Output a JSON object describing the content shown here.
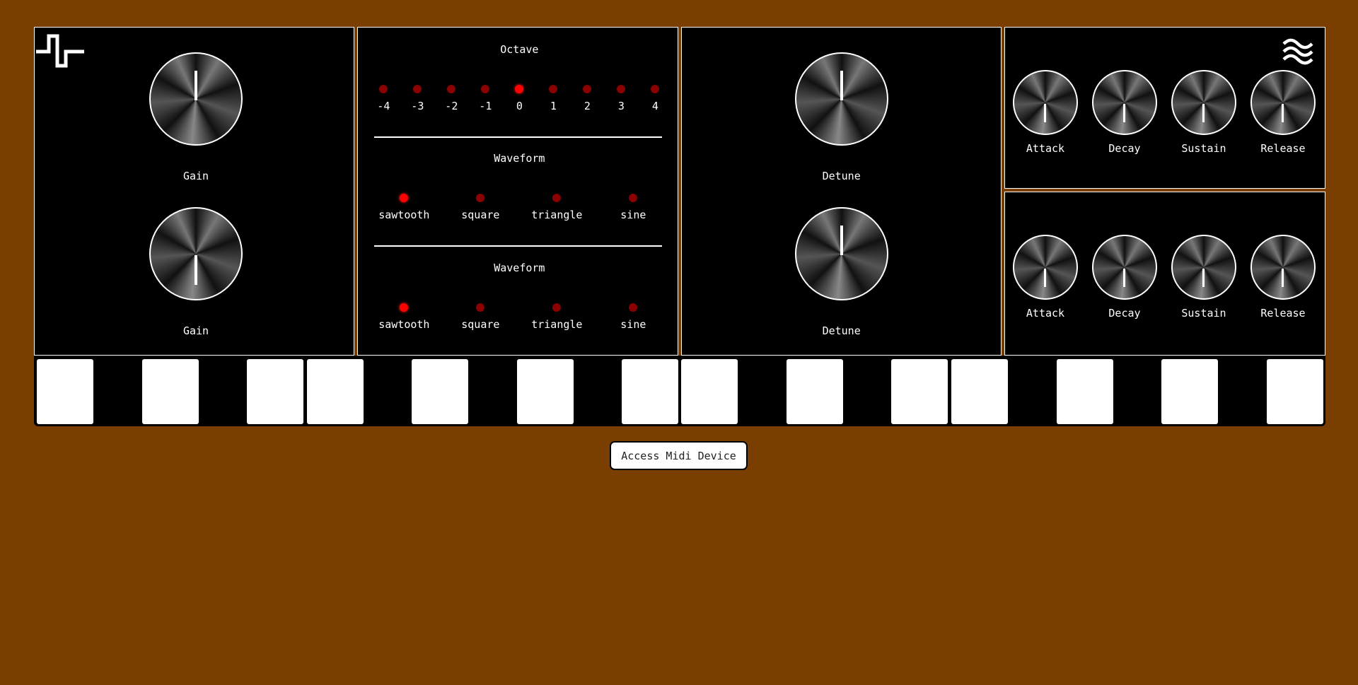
{
  "oscillators": {
    "gain_label": "Gain",
    "detune_label": "Detune",
    "square_wave_icon": "square-wave-icon",
    "noise_wave_icon": "wave-lines-icon"
  },
  "octave": {
    "title": "Octave",
    "options": [
      "-4",
      "-3",
      "-2",
      "-1",
      "0",
      "1",
      "2",
      "3",
      "4"
    ],
    "selected": "0"
  },
  "waveform1": {
    "title": "Waveform",
    "options": [
      "sawtooth",
      "square",
      "triangle",
      "sine"
    ],
    "selected": "sawtooth"
  },
  "waveform2": {
    "title": "Waveform",
    "options": [
      "sawtooth",
      "square",
      "triangle",
      "sine"
    ],
    "selected": "sawtooth"
  },
  "envelope1": {
    "labels": [
      "Attack",
      "Decay",
      "Sustain",
      "Release"
    ]
  },
  "envelope2": {
    "labels": [
      "Attack",
      "Decay",
      "Sustain",
      "Release"
    ]
  },
  "midi_button": {
    "label": "Access Midi Device"
  },
  "colors": {
    "background": "#7a3e00",
    "panel": "#000000",
    "led_on": "#ff0000",
    "led_off": "#8b0000"
  }
}
